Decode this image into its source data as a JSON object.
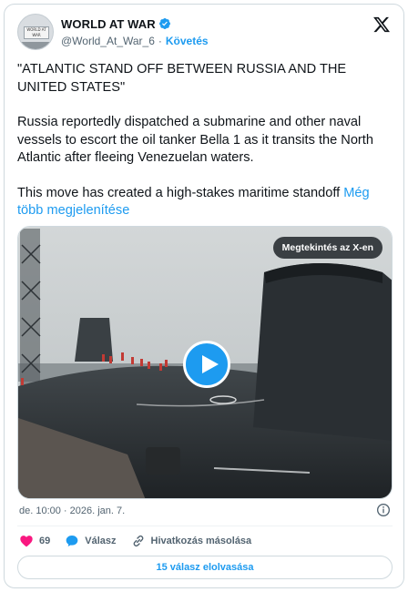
{
  "header": {
    "display_name": "WORLD AT WAR",
    "handle": "@World_At_War_6",
    "separator": "·",
    "follow_label": "Követés",
    "avatar_text": "WORLD AT WAR"
  },
  "tweet": {
    "paragraphs": [
      "\"ATLANTIC STAND OFF BETWEEN RUSSIA AND THE UNITED STATES\"",
      "Russia reportedly dispatched a submarine and other naval vessels to escort the oil tanker Bella 1 as it transits the North Atlantic after fleeing Venezuelan waters."
    ],
    "last_paragraph": "This move has created a high-stakes maritime standoff",
    "show_more": "Még több megjelenítése"
  },
  "media": {
    "watch_on_x": "Megtekintés az X-en"
  },
  "meta": {
    "timestamp": "de. 10:00 · 2026. jan. 7."
  },
  "actions": {
    "like_count": "69",
    "reply_label": "Válasz",
    "copy_link_label": "Hivatkozás másolása"
  },
  "read_replies": "15 válasz elolvasása",
  "colors": {
    "accent": "#1d9bf0",
    "like": "#f91880",
    "text": "#0f1419",
    "muted": "#536471"
  },
  "icons": [
    "verified-badge-icon",
    "x-logo-icon",
    "play-icon",
    "info-icon",
    "heart-icon",
    "reply-bubble-icon",
    "link-icon"
  ]
}
